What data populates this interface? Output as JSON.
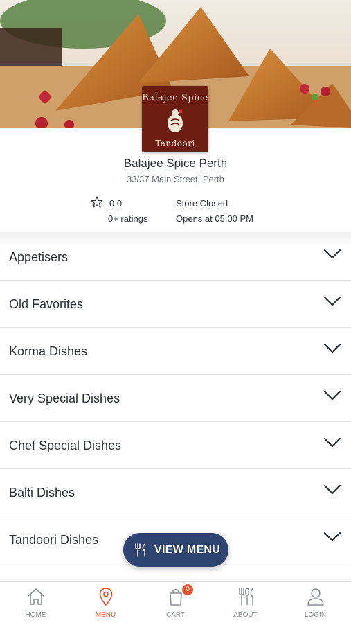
{
  "restaurant": {
    "logo_text_top": "Balajee Spice",
    "logo_text_bottom": "Tandoori",
    "name": "Balajee Spice Perth",
    "address": "33/37 Main Street, Perth",
    "rating": "0.0",
    "ratings_count": "0+ ratings",
    "status": "Store Closed",
    "hours": "Opens at 05:00 PM"
  },
  "menu_categories": [
    {
      "label": "Appetisers"
    },
    {
      "label": "Old Favorites"
    },
    {
      "label": "Korma Dishes"
    },
    {
      "label": "Very Special Dishes"
    },
    {
      "label": "Chef Special Dishes"
    },
    {
      "label": "Balti Dishes"
    },
    {
      "label": "Tandoori Dishes"
    }
  ],
  "fab": {
    "label": "VIEW MENU",
    "icon": "utensils-icon"
  },
  "tabs": [
    {
      "label": "HOME",
      "icon": "home-icon"
    },
    {
      "label": "MENU",
      "icon": "location-pin-icon",
      "active": true
    },
    {
      "label": "CART",
      "icon": "shopping-bag-icon",
      "badge": "0"
    },
    {
      "label": "ABOUT",
      "icon": "cutlery-icon"
    },
    {
      "label": "LOGIN",
      "icon": "user-icon"
    }
  ],
  "colors": {
    "accent": "#e8542d",
    "fab": "#2f4371",
    "logo_bg": "#6b1d12"
  }
}
